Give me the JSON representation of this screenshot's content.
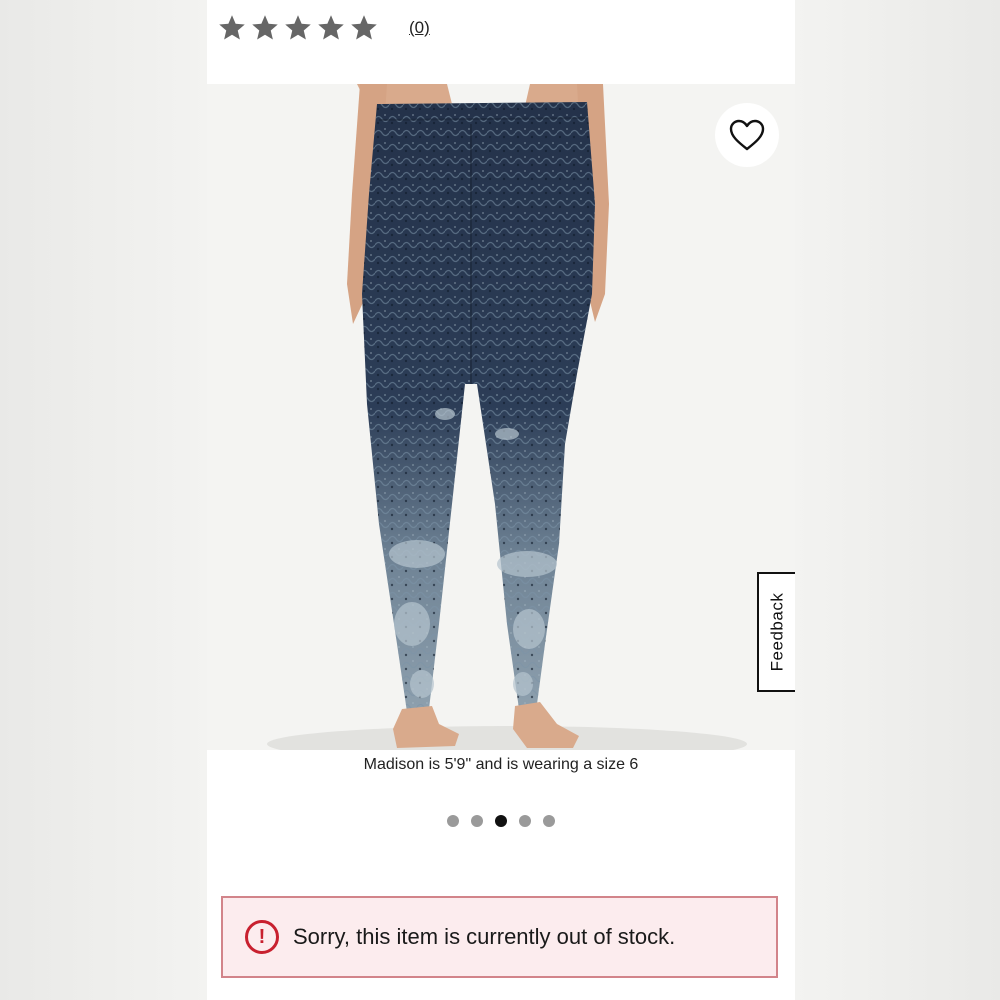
{
  "rating": {
    "stars": 5,
    "filled": 0,
    "review_count": "(0)"
  },
  "product_image": {
    "favorite_icon": "heart-outline-icon"
  },
  "feedback": {
    "label": "Feedback"
  },
  "caption": "Madison is 5'9\" and is wearing a size 6",
  "carousel": {
    "total": 5,
    "active_index": 2
  },
  "stock_alert": {
    "icon": "exclamation-circle-icon",
    "message": "Sorry, this item is currently out of stock."
  },
  "colors": {
    "alert_border": "#d2848a",
    "alert_background": "#fcecee",
    "alert_icon": "#c8202f",
    "star": "#666666"
  }
}
